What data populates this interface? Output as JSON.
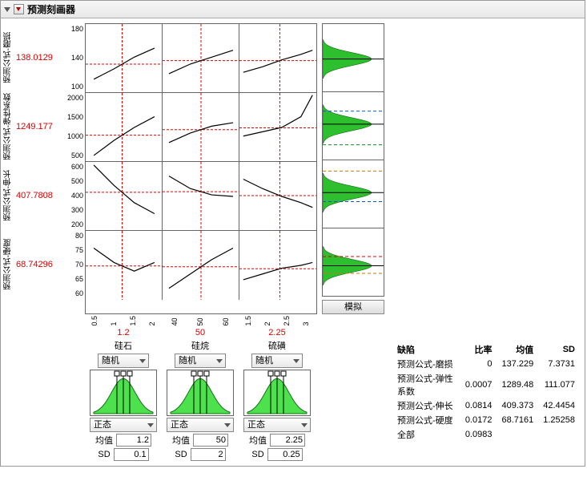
{
  "panel_title": "预测刻画器",
  "responses": [
    {
      "label": "预测公式-磨损",
      "value": "138.0129",
      "ticks": [
        "180",
        "140",
        "100"
      ]
    },
    {
      "label": "预测公式-弹性系数",
      "value": "1249.177",
      "ticks": [
        "2000",
        "1500",
        "1000",
        "500"
      ]
    },
    {
      "label": "预测公式-伸长",
      "value": "407.7808",
      "ticks": [
        "600",
        "500",
        "400",
        "300",
        "200"
      ]
    },
    {
      "label": "预测公式-硬度",
      "value": "68.74296",
      "ticks": [
        "80",
        "75",
        "70",
        "65",
        "60"
      ]
    }
  ],
  "factors": [
    {
      "name": "硅石",
      "current": "1.2",
      "ticks": [
        "0.5",
        "1",
        "1.5",
        "2"
      ],
      "random_label": "随机",
      "dist_label": "正态",
      "mean_label": "均值",
      "mean": "1.2",
      "sd_label": "SD",
      "sd": "0.1"
    },
    {
      "name": "硅烷",
      "current": "50",
      "ticks": [
        "40",
        "50",
        "60"
      ],
      "random_label": "随机",
      "dist_label": "正态",
      "mean_label": "均值",
      "mean": "50",
      "sd_label": "SD",
      "sd": "2"
    },
    {
      "name": "硫磺",
      "current": "2.25",
      "ticks": [
        "1.5",
        "2",
        "2.5",
        "3"
      ],
      "random_label": "随机",
      "dist_label": "正态",
      "mean_label": "均值",
      "mean": "2.25",
      "sd_label": "SD",
      "sd": "0.25"
    }
  ],
  "sim_button": "模拟",
  "stats": {
    "headers": [
      "缺陷",
      "比率",
      "均值",
      "SD"
    ],
    "rows": [
      {
        "name": "预测公式-磨损",
        "rate": "0",
        "mean": "137.229",
        "sd": "7.3731"
      },
      {
        "name": "预测公式-弹性系数",
        "rate": "0.0007",
        "mean": "1289.48",
        "sd": "111.077"
      },
      {
        "name": "预测公式-伸长",
        "rate": "0.0814",
        "mean": "409.373",
        "sd": "42.4454"
      },
      {
        "name": "预测公式-硬度",
        "rate": "0.0172",
        "mean": "68.7161",
        "sd": "1.25258"
      },
      {
        "name": "全部",
        "rate": "0.0983",
        "mean": "",
        "sd": ""
      }
    ]
  },
  "chart_data": {
    "type": "profiler-grid",
    "rows": [
      {
        "response": "磨损",
        "ylim": [
          90,
          190
        ],
        "cells": [
          {
            "factor": "硅石",
            "x": [
              0.5,
              1,
              1.5,
              2
            ],
            "y": [
              110,
              125,
              142,
              155
            ]
          },
          {
            "factor": "硅烷",
            "x": [
              35,
              45,
              55,
              65
            ],
            "y": [
              118,
              132,
              142,
              152
            ]
          },
          {
            "factor": "硫磺",
            "x": [
              1.3,
              1.8,
              2.3,
              2.8,
              3.1
            ],
            "y": [
              120,
              128,
              138,
              146,
              152
            ]
          }
        ],
        "sim_hist": {
          "peak": 138,
          "lo_spec": null,
          "hi_spec": null
        }
      },
      {
        "response": "弹性系数",
        "ylim": [
          450,
          2050
        ],
        "cells": [
          {
            "factor": "硅石",
            "x": [
              0.5,
              1,
              1.5,
              2
            ],
            "y": [
              600,
              950,
              1250,
              1500
            ]
          },
          {
            "factor": "硅烷",
            "x": [
              35,
              45,
              55,
              65
            ],
            "y": [
              900,
              1120,
              1280,
              1360
            ]
          },
          {
            "factor": "硫磺",
            "x": [
              1.3,
              1.8,
              2.3,
              2.8,
              3.1
            ],
            "y": [
              1050,
              1150,
              1250,
              1500,
              2000
            ]
          }
        ],
        "sim_hist": {
          "peak": 1290,
          "lo_spec": 800,
          "hi_spec": 1600
        }
      },
      {
        "response": "伸长",
        "ylim": [
          180,
          620
        ],
        "cells": [
          {
            "factor": "硅石",
            "x": [
              0.5,
              1,
              1.5,
              2
            ],
            "y": [
              600,
              470,
              360,
              290
            ]
          },
          {
            "factor": "硅烷",
            "x": [
              35,
              45,
              55,
              65
            ],
            "y": [
              530,
              450,
              410,
              400
            ]
          },
          {
            "factor": "硫磺",
            "x": [
              1.3,
              1.8,
              2.3,
              2.8,
              3.1
            ],
            "y": [
              510,
              450,
              400,
              360,
              330
            ]
          }
        ],
        "sim_hist": {
          "peak": 409,
          "lo_spec": 350,
          "hi_spec": 550
        }
      },
      {
        "response": "硬度",
        "ylim": [
          58,
          82
        ],
        "cells": [
          {
            "factor": "硅石",
            "x": [
              0.5,
              1,
              1.5,
              2
            ],
            "y": [
              76,
              71,
              68,
              71
            ]
          },
          {
            "factor": "硅烷",
            "x": [
              35,
              45,
              55,
              65
            ],
            "y": [
              62,
              67,
              72,
              76
            ]
          },
          {
            "factor": "硫磺",
            "x": [
              1.3,
              1.8,
              2.3,
              2.8,
              3.1
            ],
            "y": [
              65,
              67,
              69,
              70,
              71
            ]
          }
        ],
        "sim_hist": {
          "peak": 68.7,
          "lo_spec": 66,
          "hi_spec": 72
        }
      }
    ],
    "factor_axes": [
      {
        "name": "硅石",
        "lim": [
          0.3,
          2.2
        ],
        "current": 1.2
      },
      {
        "name": "硅烷",
        "lim": [
          32,
          68
        ],
        "current": 50
      },
      {
        "name": "硫磺",
        "lim": [
          1.2,
          3.2
        ],
        "current": 2.25
      }
    ]
  }
}
